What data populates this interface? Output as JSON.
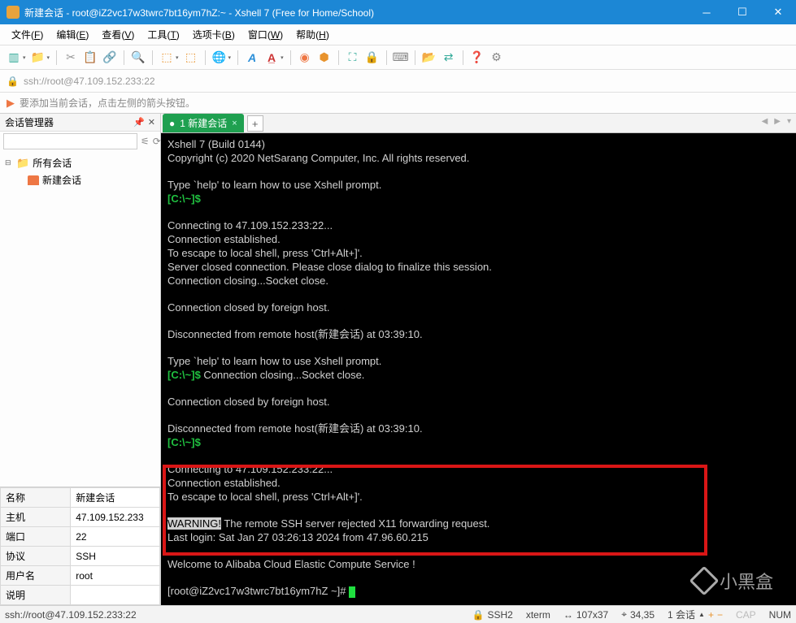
{
  "titlebar": {
    "title": "新建会话 - root@iZ2vc17w3twrc7bt16ym7hZ:~ - Xshell 7 (Free for Home/School)"
  },
  "menubar": {
    "items": [
      {
        "label": "文件",
        "key": "F"
      },
      {
        "label": "编辑",
        "key": "E"
      },
      {
        "label": "查看",
        "key": "V"
      },
      {
        "label": "工具",
        "key": "T"
      },
      {
        "label": "选项卡",
        "key": "B"
      },
      {
        "label": "窗口",
        "key": "W"
      },
      {
        "label": "帮助",
        "key": "H"
      }
    ]
  },
  "address": {
    "value": "ssh://root@47.109.152.233:22"
  },
  "tip": {
    "text": "要添加当前会话，点击左侧的箭头按钮。"
  },
  "sidebar": {
    "title": "会话管理器",
    "root": "所有会话",
    "session": "新建会话"
  },
  "props": {
    "rows": [
      {
        "k": "名称",
        "v": "新建会话"
      },
      {
        "k": "主机",
        "v": "47.109.152.233"
      },
      {
        "k": "端口",
        "v": "22"
      },
      {
        "k": "协议",
        "v": "SSH"
      },
      {
        "k": "用户名",
        "v": "root"
      },
      {
        "k": "说明",
        "v": ""
      }
    ]
  },
  "tab": {
    "label": "1 新建会话",
    "add": "+"
  },
  "terminal": {
    "l1": "Xshell 7 (Build 0144)",
    "l2": "Copyright (c) 2020 NetSarang Computer, Inc. All rights reserved.",
    "l3": "Type `help' to learn how to use Xshell prompt.",
    "p1": "[C:\\~]$",
    "l4": "Connecting to 47.109.152.233:22...",
    "l5": "Connection established.",
    "l6": "To escape to local shell, press 'Ctrl+Alt+]'.",
    "l7": "Server closed connection. Please close dialog to finalize this session.",
    "l8": "Connection closing...Socket close.",
    "l9": "Connection closed by foreign host.",
    "l10": "Disconnected from remote host(新建会话) at 03:39:10.",
    "l11": "Type `help' to learn how to use Xshell prompt.",
    "p2": "[C:\\~]$",
    "l12": " Connection closing...Socket close.",
    "l13": "Connection closed by foreign host.",
    "l14": "Disconnected from remote host(新建会话) at 03:39:10.",
    "p3": "[C:\\~]$",
    "l15": "Connecting to 47.109.152.233:22...",
    "l16": "Connection established.",
    "l17": "To escape to local shell, press 'Ctrl+Alt+]'.",
    "warn": "WARNING!",
    "l18": " The remote SSH server rejected X11 forwarding request.",
    "l19": "Last login: Sat Jan 27 03:26:13 2024 from 47.96.60.215",
    "l20": "Welcome to Alibaba Cloud Elastic Compute Service !",
    "prompt": "[root@iZ2vc17w3twrc7bt16ym7hZ ~]# "
  },
  "statusbar": {
    "left": "ssh://root@47.109.152.233:22",
    "ssh": "SSH2",
    "term": "xterm",
    "size": "107x37",
    "pos": "34,35",
    "sess": "1 会话",
    "cap": "CAP",
    "num": "NUM"
  },
  "watermark": "小黑盒"
}
